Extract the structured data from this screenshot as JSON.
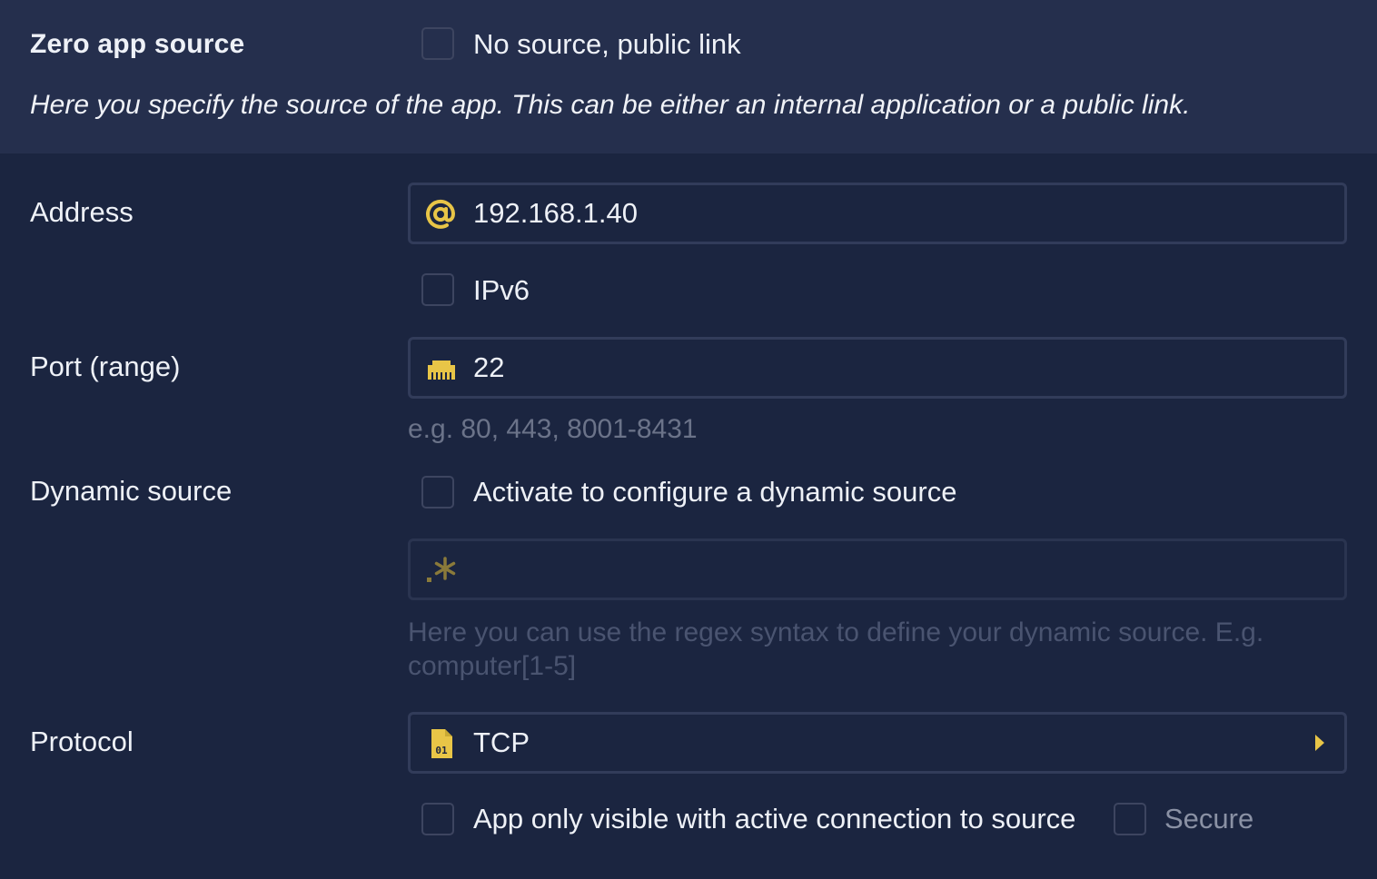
{
  "section": {
    "title": "Zero app source",
    "public_link_label": "No source, public link",
    "description": "Here you specify the source of the app. This can be either an internal application or a public link."
  },
  "address": {
    "label": "Address",
    "value": "192.168.1.40",
    "icon": "at-icon",
    "ipv6_label": "IPv6"
  },
  "port": {
    "label": "Port (range)",
    "value": "22",
    "icon": "ethernet-port-icon",
    "hint": "e.g. 80, 443, 8001-8431"
  },
  "dynamic_source": {
    "label": "Dynamic source",
    "checkbox_label": "Activate to configure a dynamic source",
    "icon": "regex-icon",
    "hint": "Here you can use the regex syntax to define your dynamic source. E.g. computer[1-5]"
  },
  "protocol": {
    "label": "Protocol",
    "value": "TCP",
    "icon": "binary-file-icon",
    "visible_label": "App only visible with active connection to source",
    "secure_label": "Secure"
  },
  "colors": {
    "accent": "#e8c547",
    "background": "#1b2540",
    "header_background": "#252f4d",
    "field_border": "#323c5a"
  }
}
